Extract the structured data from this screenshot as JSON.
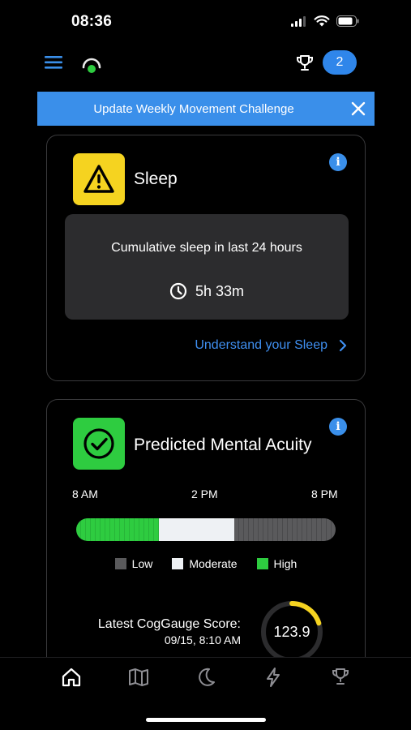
{
  "status_bar": {
    "time": "08:36"
  },
  "header": {
    "notification_count": "2"
  },
  "banner": {
    "text": "Update Weekly Movement Challenge"
  },
  "sleep_card": {
    "title": "Sleep",
    "caption": "Cumulative sleep in last 24 hours",
    "duration": "5h 33m",
    "link_label": "Understand your Sleep",
    "status_icon": "warning-icon",
    "accent": "#f5d320"
  },
  "acuity_card": {
    "title": "Predicted Mental Acuity",
    "status_icon": "check-icon",
    "accent": "#2ecc40",
    "time_labels": [
      "8 AM",
      "2 PM",
      "8 PM"
    ],
    "timeline": [
      {
        "level": "high",
        "fraction": 0.32
      },
      {
        "level": "moderate",
        "fraction": 0.29
      },
      {
        "level": "low",
        "fraction": 0.39
      }
    ],
    "legend": [
      {
        "label": "Low",
        "color": "#5a5a5c"
      },
      {
        "label": "Moderate",
        "color": "#eef1f4"
      },
      {
        "label": "High",
        "color": "#2ecc40"
      }
    ],
    "score_title": "Latest CogGauge Score:",
    "score_date": "09/15, 8:10 AM",
    "score_value": "123.9",
    "gauge_fraction": 0.2,
    "gauge_color": "#f5d320"
  },
  "tab_bar": {
    "tabs": [
      "home-icon",
      "map-icon",
      "moon-icon",
      "lightning-icon",
      "trophy-icon"
    ],
    "active": "home-icon"
  }
}
